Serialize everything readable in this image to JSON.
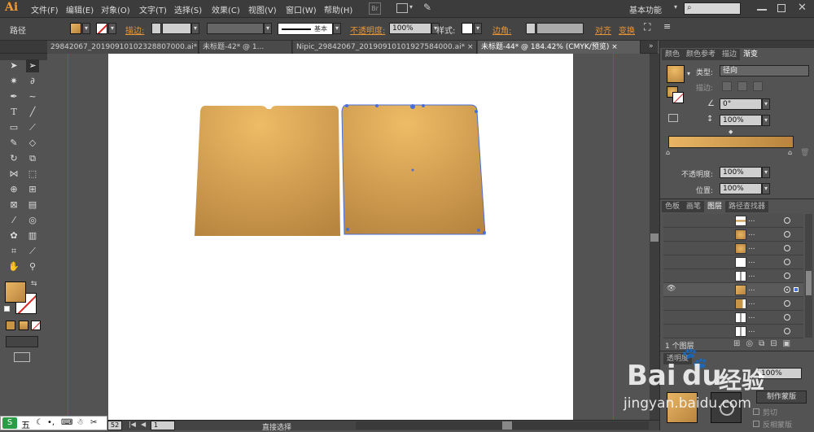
{
  "app": {
    "logo": "Ai",
    "workspace": "基本功能",
    "workspace_arrow": "▾",
    "search_placeholder": ""
  },
  "menu": [
    "文件(F)",
    "编辑(E)",
    "对象(O)",
    "文字(T)",
    "选择(S)",
    "效果(C)",
    "视图(V)",
    "窗口(W)",
    "帮助(H)"
  ],
  "control": {
    "selection_label": "路径",
    "stroke_label": "描边:",
    "stroke_style": "基本",
    "opacity_label": "不透明度:",
    "opacity_value": "100%",
    "style_label": "样式:",
    "corner_label": "边角:",
    "align_label": "对齐",
    "transform_label": "变换",
    "bridge_label": "Br"
  },
  "tabs": [
    {
      "label": "29842067_20190910102328807000.ai*",
      "active": false
    },
    {
      "label": "未标题-42* @ 1...",
      "active": false
    },
    {
      "label": "Nipic_29842067_20190910101927584000.ai*",
      "active": false
    },
    {
      "label": "未标题-44* @ 184.42% (CMYK/预览)",
      "active": true
    }
  ],
  "tab_close": "×",
  "status": {
    "zoom": "52",
    "page": "1",
    "tool_name": "直接选择"
  },
  "right_panel": {
    "gradient_tabs": [
      "颜色",
      "颜色参考",
      "描边",
      "渐变"
    ],
    "type_label": "类型:",
    "type_value": "径向",
    "stroke_label": "描边:",
    "angle_value": "0°",
    "aspect_value": "100%",
    "opacity_label": "不透明度:",
    "opacity_value": "100%",
    "location_label": "位置:",
    "location_value": "100%",
    "layer_tabs": [
      "色板",
      "画笔",
      "图层",
      "路径查找器"
    ],
    "layer_count": "1 个图层",
    "layer_row_label": "...",
    "transparency_tab": "透明度",
    "make_mask_label": "制作蒙版",
    "clip_label": "剪切",
    "invert_mask_label": "反相蒙版",
    "transparency_opacity": "100%"
  },
  "colors": {
    "accent": "#e89537",
    "gradient_light": "#e9b564",
    "gradient_dark": "#b8843e",
    "selection_blue": "#4a6fd8"
  },
  "watermark": {
    "brand": "Bai",
    "brand_mark": "du",
    "site_cn": "经验",
    "url": "jingyan.baidu.com"
  },
  "ime": {
    "glyph": "五"
  }
}
